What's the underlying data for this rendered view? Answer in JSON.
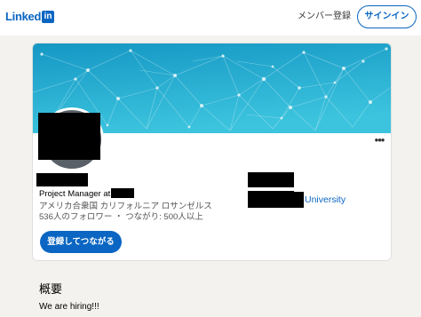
{
  "header": {
    "logo_text": "Linked",
    "logo_box": "in",
    "join_label": "メンバー登録",
    "signin_label": "サインイン"
  },
  "profile": {
    "headline": "Project Manager at",
    "location": "アメリカ合衆国 カリフォルニア ロサンゼルス",
    "followers": "536人のフォロワー",
    "separator": "・",
    "connections": "つながり: 500人以上",
    "connect_label": "登録してつながる",
    "more_glyph": "•••"
  },
  "education": {
    "school_suffix": "University"
  },
  "about": {
    "title": "概要",
    "text": "We are hiring!!!"
  },
  "colors": {
    "brand": "#0a66c2",
    "cover_top": "#1aa0c8",
    "cover_bottom": "#3ec7e0"
  }
}
